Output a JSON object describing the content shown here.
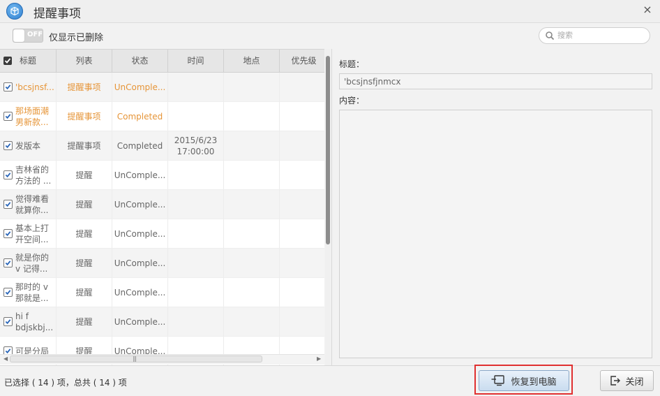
{
  "window": {
    "title": "提醒事项",
    "close_glyph": "×"
  },
  "toolbar": {
    "toggle_state": "OFF",
    "only_deleted_label": "仅显示已删除",
    "search_placeholder": "搜索"
  },
  "table": {
    "columns": [
      "标题",
      "列表",
      "状态",
      "时间",
      "地点",
      "优先级"
    ],
    "rows": [
      {
        "title": "'bcsjnsf...",
        "list": "提醒事项",
        "status": "UnComple...",
        "time": "",
        "place": "",
        "priority": "",
        "highlight": true
      },
      {
        "title": "那场面潮\n男新款...",
        "list": "提醒事项",
        "status": "Completed",
        "time": "",
        "place": "",
        "priority": "",
        "highlight": true
      },
      {
        "title": "发版本",
        "list": "提醒事项",
        "status": "Completed",
        "time": "2015/6/23\n17:00:00",
        "place": "",
        "priority": "",
        "highlight": false
      },
      {
        "title": "吉林省的\n方法的 ...",
        "list": "提醒",
        "status": "UnComple...",
        "time": "",
        "place": "",
        "priority": "",
        "highlight": false
      },
      {
        "title": "觉得难看\n就算你...",
        "list": "提醒",
        "status": "UnComple...",
        "time": "",
        "place": "",
        "priority": "",
        "highlight": false
      },
      {
        "title": "基本上打\n开空间...",
        "list": "提醒",
        "status": "UnComple...",
        "time": "",
        "place": "",
        "priority": "",
        "highlight": false
      },
      {
        "title": "就是你的\nv 记得...",
        "list": "提醒",
        "status": "UnComple...",
        "time": "",
        "place": "",
        "priority": "",
        "highlight": false
      },
      {
        "title": "那时的 v\n那就是...",
        "list": "提醒",
        "status": "UnComple...",
        "time": "",
        "place": "",
        "priority": "",
        "highlight": false
      },
      {
        "title": "hi f\nbdjskbj...",
        "list": "提醒",
        "status": "UnComple...",
        "time": "",
        "place": "",
        "priority": "",
        "highlight": false
      },
      {
        "title": "可是分局",
        "list": "提醒",
        "status": "UnComple...",
        "time": "",
        "place": "",
        "priority": "",
        "highlight": false
      }
    ]
  },
  "detail": {
    "title_label": "标题：",
    "title_value": "'bcsjnsfjnmcx",
    "content_label": "内容："
  },
  "footer": {
    "status_text": "已选择 ( 14 ) 项，总共 ( 14 ) 项",
    "restore_label": "恢复到电脑",
    "close_label": "关闭"
  },
  "colors": {
    "accent_orange": "#e69538",
    "highlight_red": "#e03030"
  }
}
